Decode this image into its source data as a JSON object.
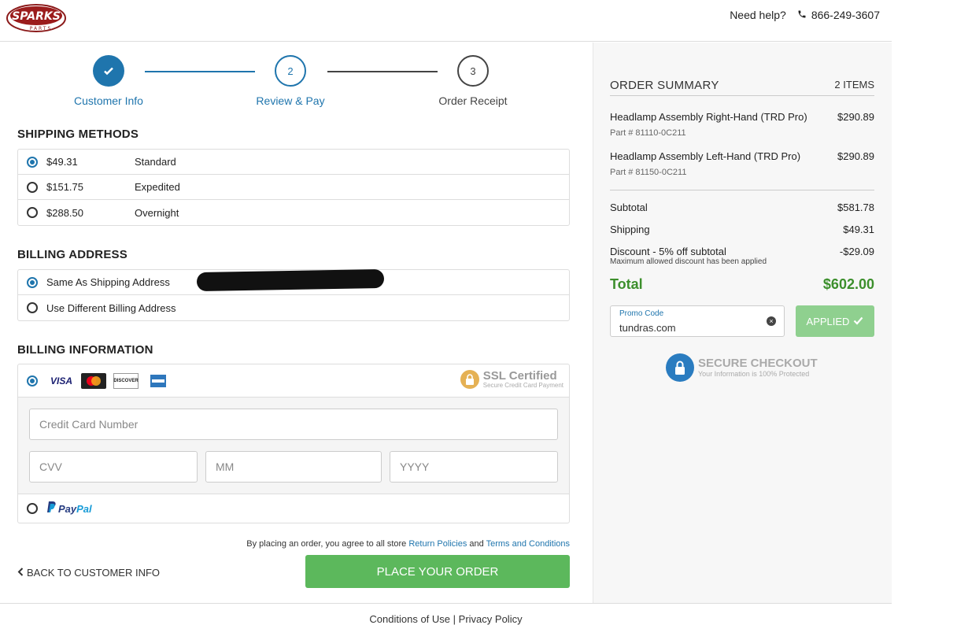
{
  "header": {
    "logo_text": "SPARKS",
    "logo_subtext": "PARTS",
    "help_label": "Need help?",
    "phone": "866-249-3607"
  },
  "steps": [
    {
      "number": "1",
      "label": "Customer Info",
      "state": "complete"
    },
    {
      "number": "2",
      "label": "Review & Pay",
      "state": "active"
    },
    {
      "number": "3",
      "label": "Order Receipt",
      "state": "pending"
    }
  ],
  "shipping": {
    "title": "SHIPPING METHODS",
    "options": [
      {
        "price": "$49.31",
        "name": "Standard",
        "selected": true
      },
      {
        "price": "$151.75",
        "name": "Expedited",
        "selected": false
      },
      {
        "price": "$288.50",
        "name": "Overnight",
        "selected": false
      }
    ]
  },
  "billing_address": {
    "title": "BILLING ADDRESS",
    "options": [
      {
        "label": "Same As Shipping Address",
        "selected": true
      },
      {
        "label": "Use Different Billing Address",
        "selected": false
      }
    ]
  },
  "billing_info": {
    "title": "BILLING INFORMATION",
    "cards": [
      "VISA",
      "Mastercard",
      "DISCOVER",
      "AMEX"
    ],
    "ssl_title": "SSL Certified",
    "ssl_sub": "Secure Credit Card Payment",
    "card_number_placeholder": "Credit Card Number",
    "cvv_placeholder": "CVV",
    "mm_placeholder": "MM",
    "yyyy_placeholder": "YYYY",
    "paypal_pay": "Pay",
    "paypal_pal": "Pal"
  },
  "agreement": {
    "prefix": "By placing an order, you agree to all store",
    "return_link": "Return Policies",
    "and": "and",
    "terms_link": "Terms and Conditions"
  },
  "actions": {
    "back": "BACK TO CUSTOMER INFO",
    "place_order": "PLACE YOUR ORDER"
  },
  "footer": {
    "conditions": "Conditions of Use",
    "separator": "|",
    "privacy": "Privacy Policy"
  },
  "summary": {
    "title": "ORDER SUMMARY",
    "count": "2 ITEMS",
    "items": [
      {
        "name": "Headlamp Assembly Right-Hand (TRD Pro)",
        "price": "$290.89",
        "part": "Part # 81110-0C211"
      },
      {
        "name": "Headlamp Assembly Left-Hand (TRD Pro)",
        "price": "$290.89",
        "part": "Part # 81150-0C211"
      }
    ],
    "subtotal_label": "Subtotal",
    "subtotal": "$581.78",
    "shipping_label": "Shipping",
    "shipping": "$49.31",
    "discount_label": "Discount - 5% off subtotal",
    "discount": "-$29.09",
    "discount_note": "Maximum allowed discount has been applied",
    "total_label": "Total",
    "total": "$602.00",
    "promo_label": "Promo Code",
    "promo_value": "tundras.com",
    "applied": "APPLIED",
    "secure_title": "SECURE CHECKOUT",
    "secure_sub": "Your Information is 100% Protected"
  },
  "colors": {
    "accent": "#1f75ad",
    "success": "#5cb85c",
    "total_green": "#3c8f2c"
  }
}
